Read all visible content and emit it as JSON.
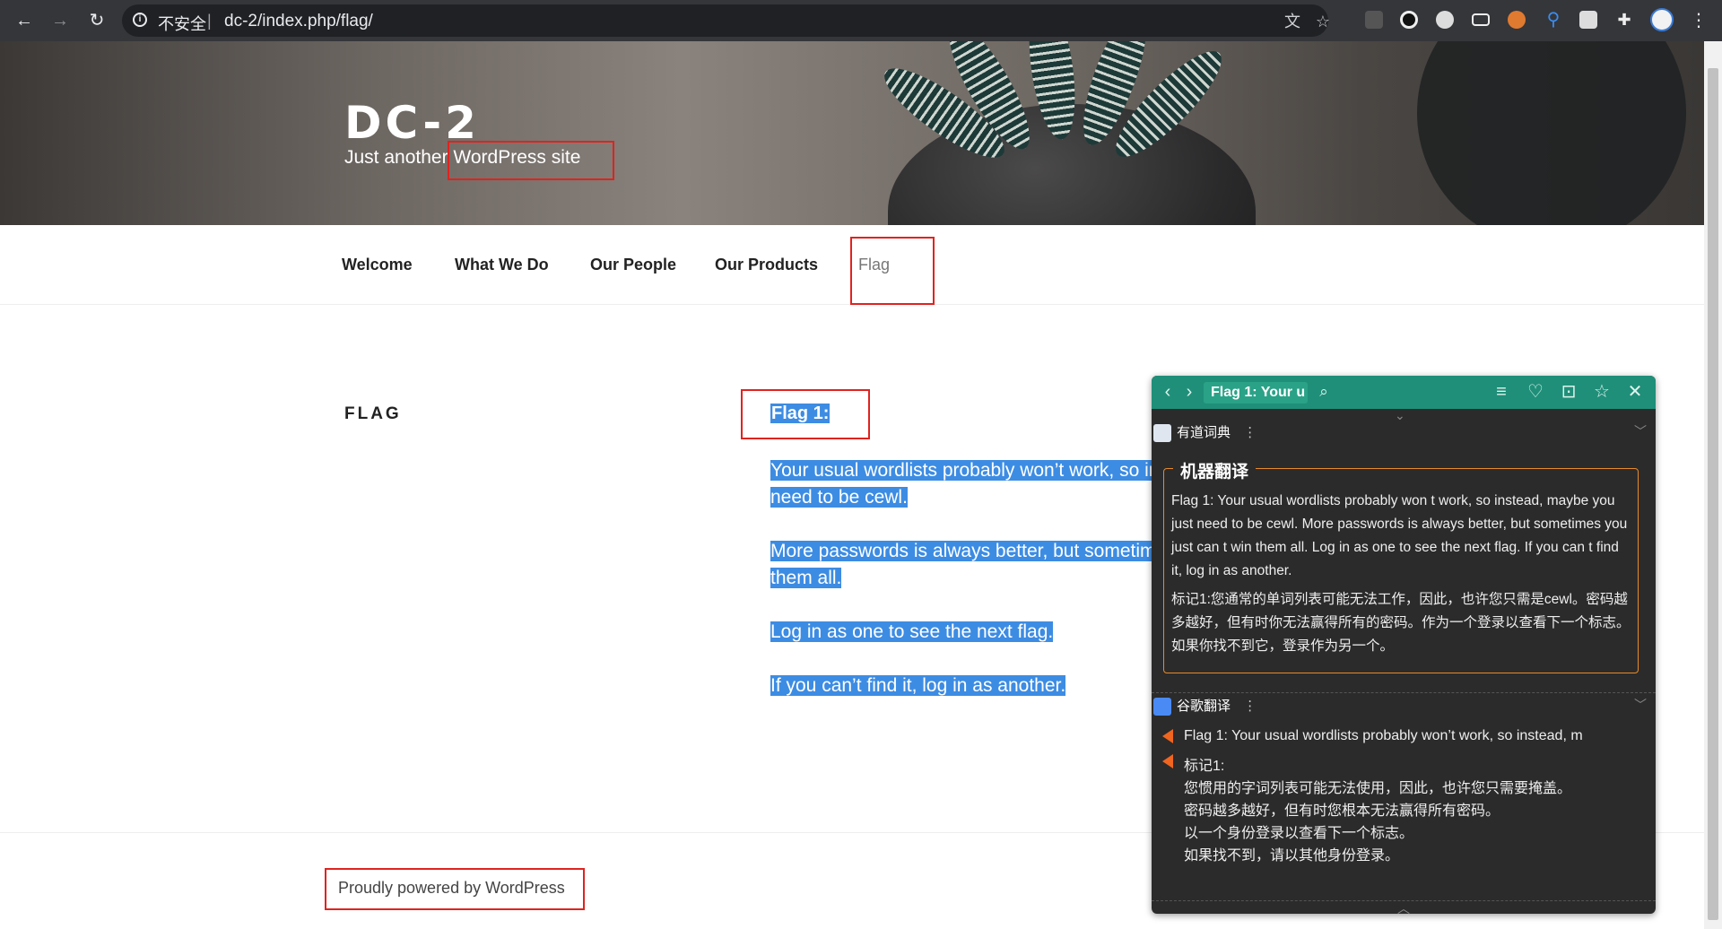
{
  "browser": {
    "security_label": "不安全",
    "url": "dc-2/index.php/flag/"
  },
  "site": {
    "title": "DC-2",
    "description": "Just another WordPress site"
  },
  "menu": {
    "items": [
      "Welcome",
      "What We Do",
      "Our People",
      "Our Products",
      "Flag"
    ]
  },
  "page": {
    "title": "FLAG",
    "heading": "Flag 1:",
    "paragraphs": [
      "Your usual wordlists probably won’t work, so instead, maybe you just",
      "need to be cewl.",
      "More passwords is always better, but sometimes you just can’t win",
      "them all.",
      "Log in as one to see the next flag.",
      "If you can’t find it, log in as another."
    ]
  },
  "footer": {
    "text": "Proudly powered by WordPress"
  },
  "popup": {
    "query": "Flag 1: Your u",
    "youdao_label": "有道词典",
    "machine_translation_label": "机器翻译",
    "mt_english": "Flag 1: Your usual wordlists probably won t work, so instead, maybe you just need to be cewl. More passwords is always better, but sometimes you just can t win them all. Log in as one to see the next flag. If you can t find it, log in as another.",
    "mt_chinese": "标记1:您通常的单词列表可能无法工作，因此，也许您只需是cewl。密码越多越好，但有时你无法赢得所有的密码。作为一个登录以查看下一个标志。如果你找不到它，登录作为另一个。",
    "google_label": "谷歌翻译",
    "google_source": "Flag 1: Your usual wordlists probably won’t work, so instead, m",
    "google_lines": [
      "标记1:",
      "您惯用的字词列表可能无法使用，因此，也许您只需要掩盖。",
      "密码越多越好，但有时您根本无法赢得所有密码。",
      "以一个身份登录以查看下一个标志。",
      "如果找不到，请以其他身份登录。"
    ]
  }
}
